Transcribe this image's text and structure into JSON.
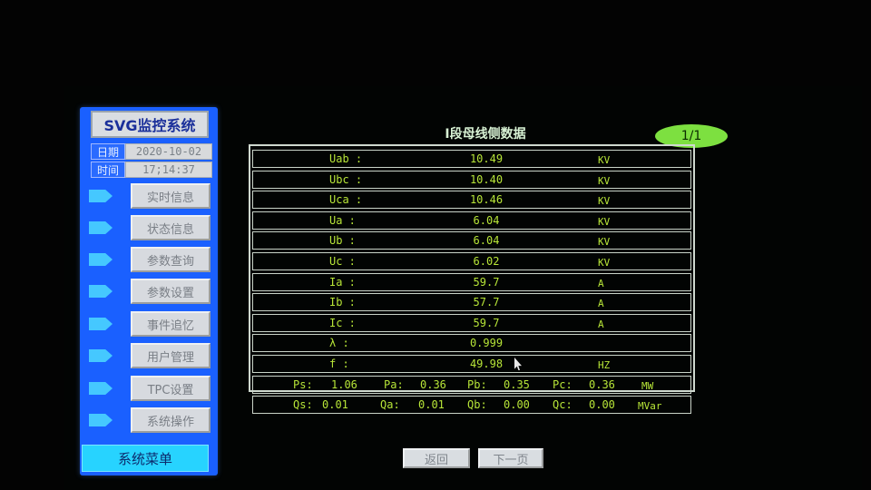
{
  "sidebar": {
    "title": "SVG监控系统",
    "date_label": "日期",
    "date_value": "2020-10-02",
    "time_label": "时间",
    "time_value": "17;14:37",
    "menu": [
      {
        "label": "实时信息"
      },
      {
        "label": "状态信息"
      },
      {
        "label": "参数查询"
      },
      {
        "label": "参数设置"
      },
      {
        "label": "事件追忆"
      },
      {
        "label": "用户管理"
      },
      {
        "label": "TPC设置"
      },
      {
        "label": "系统操作"
      }
    ],
    "system_menu": "系统菜单"
  },
  "panel": {
    "title": "I段母线侧数据",
    "page": "1/1",
    "rows": [
      {
        "label": "Uab :",
        "value": "10.49",
        "unit": "KV"
      },
      {
        "label": "Ubc :",
        "value": "10.40",
        "unit": "KV"
      },
      {
        "label": "Uca :",
        "value": "10.46",
        "unit": "KV"
      },
      {
        "label": "Ua  :",
        "value": "6.04",
        "unit": "KV"
      },
      {
        "label": "Ub  :",
        "value": "6.04",
        "unit": "KV"
      },
      {
        "label": "Uc  :",
        "value": "6.02",
        "unit": "KV"
      },
      {
        "label": "Ia  :",
        "value": "59.7",
        "unit": "A"
      },
      {
        "label": "Ib  :",
        "value": "57.7",
        "unit": "A"
      },
      {
        "label": "Ic  :",
        "value": "59.7",
        "unit": "A"
      },
      {
        "label": "λ  :",
        "value": "0.999",
        "unit": ""
      },
      {
        "label": "f  :",
        "value": "49.98",
        "unit": "HZ"
      }
    ],
    "power_p": {
      "ps_label": "Ps:",
      "ps_value": "1.06",
      "pa_label": "Pa:",
      "pa_value": "0.36",
      "pb_label": "Pb:",
      "pb_value": "0.35",
      "pc_label": "Pc:",
      "pc_value": "0.36",
      "unit": "MW"
    },
    "power_q": {
      "qs_label": "Qs:",
      "qs_value": "0.01",
      "qa_label": "Qa:",
      "qa_value": "0.01",
      "qb_label": "Qb:",
      "qb_value": "0.00",
      "qc_label": "Qc:",
      "qc_value": "0.00",
      "unit": "MVar"
    }
  },
  "nav": {
    "back_label": "返回",
    "next_label": "下一页"
  }
}
